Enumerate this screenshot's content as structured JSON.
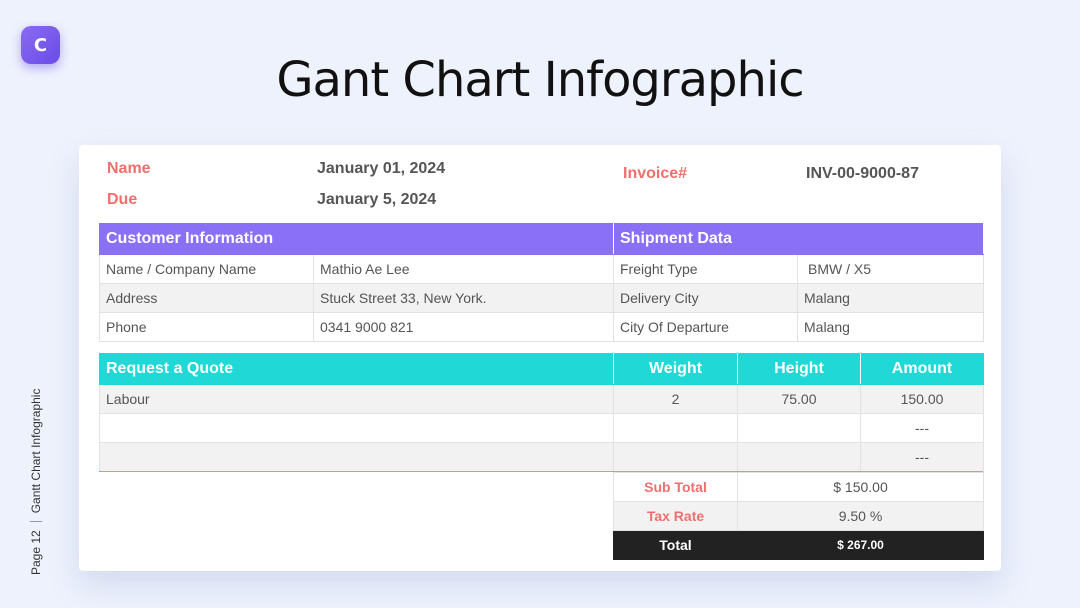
{
  "logo": {
    "letter": "C"
  },
  "title": "Gant Chart Infographic",
  "side": {
    "page": "Page 12",
    "name": "Gantt Chart Infographic"
  },
  "invoice_header": {
    "name_label": "Name",
    "name_value": "January 01, 2024",
    "due_label": "Due",
    "due_value": "January 5, 2024",
    "invoice_label": "Invoice#",
    "invoice_value": "INV-00-9000-87"
  },
  "customer": {
    "title": "Customer Information",
    "rows": [
      {
        "label": "Name / Company Name",
        "value": "Mathio Ae Lee"
      },
      {
        "label": "Address",
        "value": "Stuck Street 33, New York."
      },
      {
        "label": "Phone",
        "value": "0341 9000 821"
      }
    ]
  },
  "shipment": {
    "title": "Shipment Data",
    "rows": [
      {
        "label": "Freight Type",
        "value": "BMW / X5"
      },
      {
        "label": "Delivery City",
        "value": "Malang"
      },
      {
        "label": "City Of Departure",
        "value": "Malang"
      }
    ]
  },
  "quote": {
    "headers": [
      "Request a Quote",
      "Weight",
      "Height",
      "Amount"
    ],
    "rows": [
      [
        "Labour",
        "2",
        "75.00",
        "150.00"
      ],
      [
        "",
        "",
        "",
        "---"
      ],
      [
        "",
        "",
        "",
        "---"
      ]
    ]
  },
  "summary": {
    "subtotal_label": "Sub Total",
    "subtotal_value": "$ 150.00",
    "tax_label": "Tax Rate",
    "tax_value": "9.50 %",
    "total_label": "Total",
    "total_value": "$ 267.00"
  },
  "colors": {
    "purple": "#8a6ff7",
    "teal": "#20d8d5",
    "accent_red": "#ef6f6f",
    "total_bg": "#222222"
  }
}
